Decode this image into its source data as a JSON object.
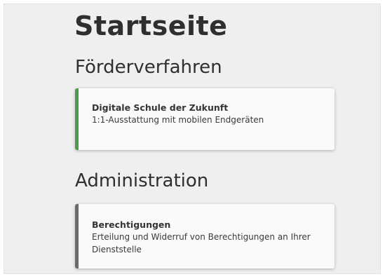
{
  "page": {
    "title": "Startseite"
  },
  "sections": {
    "foerderverfahren": {
      "title": "Förderverfahren",
      "card": {
        "title": "Digitale Schule der Zukunft",
        "description": "1:1-Ausstattung mit mobilen Endgeräten",
        "accent_color": "#4f9a4a"
      }
    },
    "administration": {
      "title": "Administration",
      "card": {
        "title": "Berechtigungen",
        "description": "Erteilung und Widerruf von Berechtigungen an Ihrer Dienststelle",
        "accent_color": "#6b6b6b"
      }
    }
  },
  "colors": {
    "background": "#efefef",
    "card_background": "#fafafa",
    "text": "#2f2f2f"
  }
}
